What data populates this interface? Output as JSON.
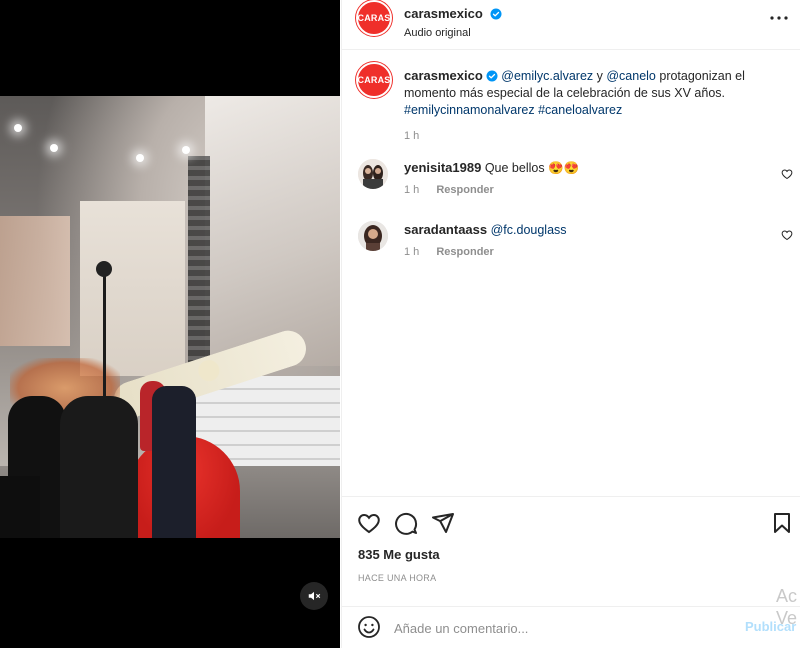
{
  "post": {
    "username": "carasmexico",
    "audio_label": "Audio original",
    "avatar_text": "CARAS",
    "brand_color": "#ef2f2a",
    "verified": true
  },
  "caption": {
    "username": "carasmexico",
    "mention_1": "@emilyc.alvarez",
    "connector": " y ",
    "mention_2": "@canelo",
    "text": " protagonizan el momento más especial de la celebración de sus XV años.",
    "hashtag_1": "#emilycinnamonalvarez",
    "hashtag_2": "#caneloalvarez",
    "time": "1 h"
  },
  "comments": [
    {
      "username": "yenisita1989",
      "text": "Que bellos 😍😍",
      "time": "1 h",
      "reply_label": "Responder"
    },
    {
      "username": "saradantaass",
      "text": "@fc.douglass",
      "time": "1 h",
      "reply_label": "Responder"
    }
  ],
  "actions": {
    "likes": "835 Me gusta",
    "timestamp": "HACE UNA HORA"
  },
  "add_comment": {
    "placeholder": "Añade un comentario...",
    "publish_label": "Publicar"
  },
  "icons": {
    "more": "more-horizontal-icon",
    "verified": "verified-badge-icon",
    "like": "heart-icon",
    "comment": "comment-bubble-icon",
    "share": "paper-plane-icon",
    "save": "bookmark-icon",
    "emoji": "emoji-smile-icon",
    "mute": "speaker-muted-icon"
  },
  "watermark": {
    "line1": "Ac",
    "line2": "Ve"
  }
}
